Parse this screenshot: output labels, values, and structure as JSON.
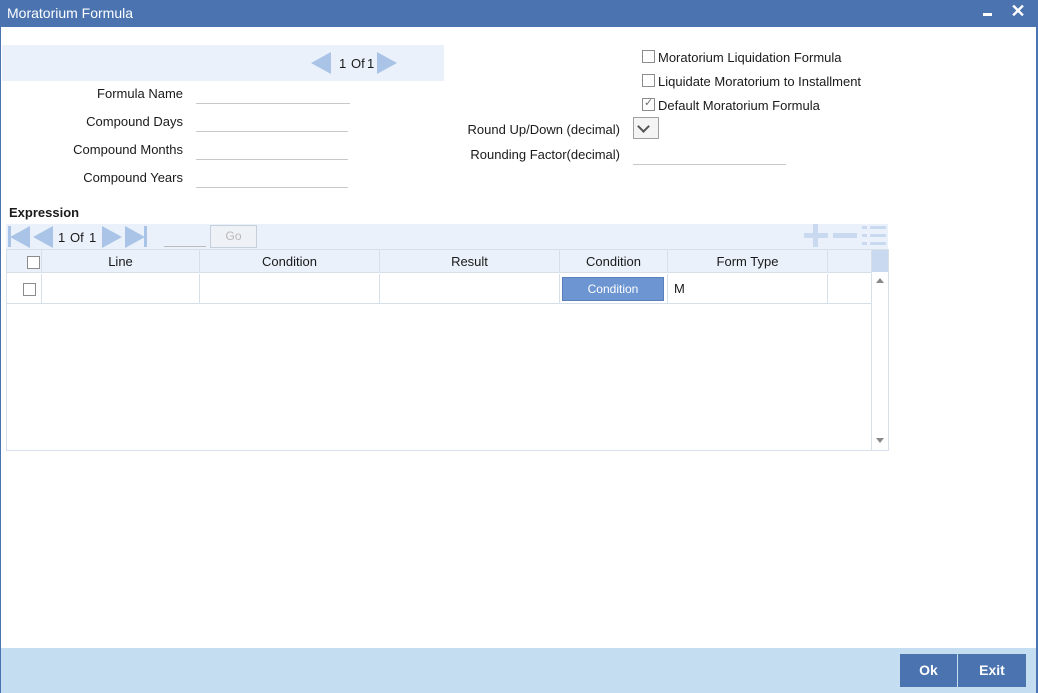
{
  "window": {
    "title": "Moratorium Formula",
    "close_glyph": "✕"
  },
  "record_nav": {
    "current": "1",
    "of_label": "Of",
    "total": "1"
  },
  "form": {
    "formula_name_label": "Formula Name",
    "formula_name_value": "",
    "compound_days_label": "Compound Days",
    "compound_days_value": "",
    "compound_months_label": "Compound Months",
    "compound_months_value": "",
    "compound_years_label": "Compound Years",
    "compound_years_value": "",
    "round_label": "Round Up/Down (decimal)",
    "round_value": "",
    "rounding_factor_label": "Rounding Factor(decimal)",
    "rounding_factor_value": ""
  },
  "checkboxes": [
    {
      "label": "Moratorium Liquidation Formula",
      "checked": false
    },
    {
      "label": "Liquidate Moratorium to Installment",
      "checked": false
    },
    {
      "label": "Default Moratorium Formula",
      "checked": true
    }
  ],
  "expression": {
    "title": "Expression",
    "pager": {
      "current": "1",
      "of_label": "Of",
      "total": "1",
      "go_label": "Go",
      "go_value": ""
    },
    "columns": [
      "Line",
      "Condition",
      "Result",
      "Condition",
      "Form Type"
    ],
    "rows": [
      {
        "line": "",
        "condition": "",
        "result": "",
        "condition_button": "Condition",
        "form_type": "M"
      }
    ]
  },
  "footer": {
    "ok_label": "Ok",
    "exit_label": "Exit"
  },
  "colors": {
    "titlebar": "#4a73b0",
    "button": "#4a73b0",
    "condition_button": "#6c95d2",
    "panel": "#eaf1fa",
    "footer": "#c5ddf0"
  }
}
